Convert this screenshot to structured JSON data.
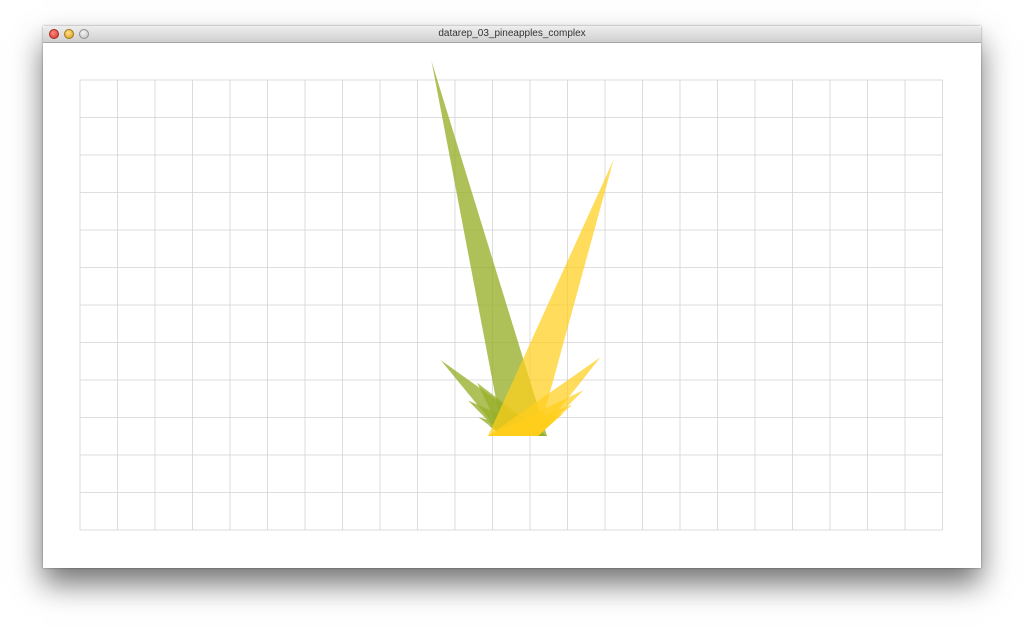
{
  "window": {
    "title": "datarep_03_pineapples_complex"
  },
  "icons": {
    "close": "close-icon",
    "minimize": "minimize-icon",
    "maximize": "maximize-icon"
  },
  "colors": {
    "grid": "#d3d3d3",
    "green": "#97b02a",
    "yellow": "#ffce1c"
  },
  "visualization": {
    "grid_columns": 23,
    "grid_rows": 12,
    "green_leaves": [
      {
        "length": 0.92,
        "angle": -14
      },
      {
        "length": 0.27,
        "angle": -48
      },
      {
        "length": 0.17,
        "angle": -42
      },
      {
        "length": 0.16,
        "angle": -58
      },
      {
        "length": 0.12,
        "angle": -68
      },
      {
        "length": 0.09,
        "angle": -74
      },
      {
        "length": 0.07,
        "angle": -80
      }
    ],
    "yellow_leaves": [
      {
        "length": 0.7,
        "angle": 20
      },
      {
        "length": 0.28,
        "angle": 48
      },
      {
        "length": 0.2,
        "angle": 57
      },
      {
        "length": 0.16,
        "angle": 62
      },
      {
        "length": 0.13,
        "angle": 66
      },
      {
        "length": 0.1,
        "angle": 70
      },
      {
        "length": 0.08,
        "angle": 74
      }
    ]
  }
}
